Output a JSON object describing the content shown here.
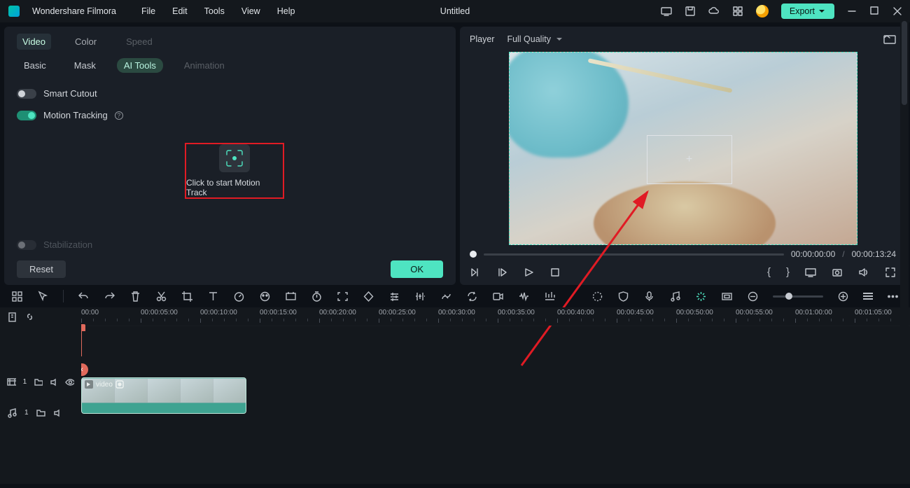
{
  "app": {
    "name": "Wondershare Filmora",
    "doc_title": "Untitled"
  },
  "menu": [
    "File",
    "Edit",
    "Tools",
    "View",
    "Help"
  ],
  "export_label": "Export",
  "left": {
    "top_tabs": [
      "Video",
      "Color",
      "Speed"
    ],
    "sub_tabs": [
      "Basic",
      "Mask",
      "AI Tools",
      "Animation"
    ],
    "smart_cutout": "Smart Cutout",
    "motion_tracking": "Motion Tracking",
    "track_label": "Click to start Motion Track",
    "stabilization": "Stabilization",
    "reset": "Reset",
    "ok": "OK"
  },
  "player": {
    "label": "Player",
    "quality": "Full Quality",
    "current": "00:00:00:00",
    "total": "00:00:13:24",
    "separator": "/"
  },
  "timeline": {
    "ticks": [
      "00:00",
      "00:00:05:00",
      "00:00:10:00",
      "00:00:15:00",
      "00:00:20:00",
      "00:00:25:00",
      "00:00:30:00",
      "00:00:35:00",
      "00:00:40:00",
      "00:00:45:00",
      "00:00:50:00",
      "00:00:55:00",
      "00:01:00:00",
      "00:01:05:00"
    ],
    "clip_label": "video",
    "video_track": "1",
    "audio_track": "1"
  }
}
